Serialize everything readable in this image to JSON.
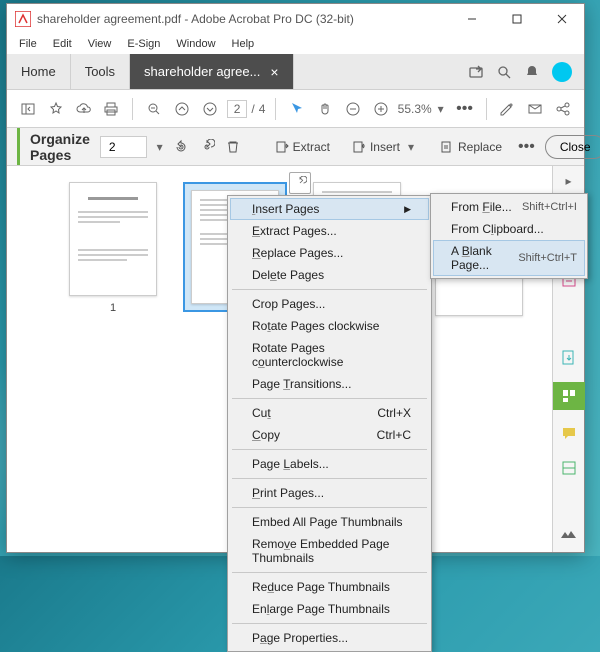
{
  "window": {
    "title": "shareholder agreement.pdf - Adobe Acrobat Pro DC (32-bit)"
  },
  "menubar": [
    "File",
    "Edit",
    "View",
    "E-Sign",
    "Window",
    "Help"
  ],
  "tabs": {
    "home": "Home",
    "tools": "Tools",
    "active": "shareholder agree..."
  },
  "toolbar": {
    "page_current": "2",
    "page_sep": "/",
    "page_total": "4",
    "zoom": "55.3%"
  },
  "organize": {
    "title": "Organize Pages",
    "page_input": "2",
    "extract": "Extract",
    "insert": "Insert",
    "replace": "Replace",
    "close": "Close"
  },
  "thumbs": {
    "p1": "1"
  },
  "context_menu": [
    {
      "label": "Insert Pages",
      "submenu": true,
      "hover": true,
      "u": 0
    },
    {
      "label": "Extract Pages...",
      "u": 0
    },
    {
      "label": "Replace Pages...",
      "u": 0
    },
    {
      "label": "Delete Pages",
      "u": 3
    },
    {
      "sep": true
    },
    {
      "label": "Crop Pages..."
    },
    {
      "label": "Rotate Pages clockwise",
      "u": 2
    },
    {
      "label": "Rotate Pages counterclockwise",
      "u": 14
    },
    {
      "label": "Page Transitions...",
      "u": 5
    },
    {
      "sep": true
    },
    {
      "label": "Cut",
      "shortcut": "Ctrl+X",
      "u": 2
    },
    {
      "label": "Copy",
      "shortcut": "Ctrl+C",
      "u": 0
    },
    {
      "sep": true
    },
    {
      "label": "Page Labels...",
      "u": 5
    },
    {
      "sep": true
    },
    {
      "label": "Print Pages...",
      "u": 0
    },
    {
      "sep": true
    },
    {
      "label": "Embed All Page Thumbnails"
    },
    {
      "label": "Remove Embedded Page Thumbnails",
      "u": 4
    },
    {
      "sep": true
    },
    {
      "label": "Reduce Page Thumbnails",
      "u": 2
    },
    {
      "label": "Enlarge Page Thumbnails",
      "u": 2
    },
    {
      "sep": true
    },
    {
      "label": "Page Properties...",
      "u": 1
    }
  ],
  "submenu": [
    {
      "label": "From File...",
      "shortcut": "Shift+Ctrl+I",
      "u": 5
    },
    {
      "label": "From Clipboard...",
      "u": 6
    },
    {
      "label": "A Blank Page...",
      "shortcut": "Shift+Ctrl+T",
      "hover": true,
      "u": 2
    }
  ]
}
